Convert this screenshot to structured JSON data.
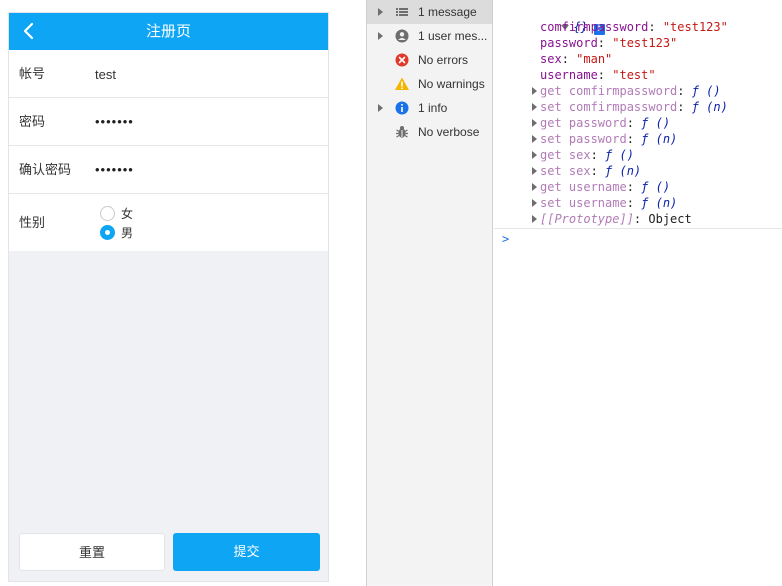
{
  "app": {
    "nav_title": "注册页",
    "back_icon": "chevron-left-icon",
    "accent": "#0ea5f5"
  },
  "form": {
    "username_label": "帐号",
    "username_value": "test",
    "password_label": "密码",
    "password_dots": "•••••••",
    "confirm_label": "确认密码",
    "confirm_dots": "•••••••",
    "gender_label": "性别",
    "gender_options": [
      "女",
      "男"
    ],
    "gender_selected": "男",
    "reset_label": "重置",
    "submit_label": "提交"
  },
  "devtools": {
    "sidebar": [
      {
        "label": "1 message",
        "icon": "list-icon",
        "expandable": true,
        "active": true
      },
      {
        "label": "1 user mes...",
        "icon": "user-icon",
        "expandable": true,
        "active": false
      },
      {
        "label": "No errors",
        "icon": "error-icon",
        "expandable": false,
        "active": false
      },
      {
        "label": "No warnings",
        "icon": "warning-icon",
        "expandable": false,
        "active": false
      },
      {
        "label": "1 info",
        "icon": "info-icon",
        "expandable": true,
        "active": false
      },
      {
        "label": "No verbose",
        "icon": "bug-icon",
        "expandable": false,
        "active": false
      }
    ],
    "console": {
      "object_head": "{}",
      "info_badge": "i",
      "props": [
        {
          "key": "comfirmpassword",
          "value": "\"test123\""
        },
        {
          "key": "password",
          "value": "\"test123\""
        },
        {
          "key": "sex",
          "value": "\"man\""
        },
        {
          "key": "username",
          "value": "\"test\""
        }
      ],
      "accessors": [
        {
          "key": "get comfirmpassword",
          "value": "ƒ ()"
        },
        {
          "key": "set comfirmpassword",
          "value": "ƒ (n)"
        },
        {
          "key": "get password",
          "value": "ƒ ()"
        },
        {
          "key": "set password",
          "value": "ƒ (n)"
        },
        {
          "key": "get sex",
          "value": "ƒ ()"
        },
        {
          "key": "set sex",
          "value": "ƒ (n)"
        },
        {
          "key": "get username",
          "value": "ƒ ()"
        },
        {
          "key": "set username",
          "value": "ƒ (n)"
        }
      ],
      "prototype_key": "[[Prototype]]",
      "prototype_value": "Object",
      "prompt": ">"
    }
  }
}
